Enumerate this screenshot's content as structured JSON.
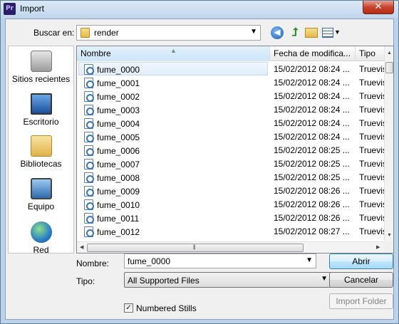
{
  "window": {
    "title": "Import",
    "app_icon": "Pr",
    "close_glyph": "✕"
  },
  "toolbar": {
    "look_in_label": "Buscar en:",
    "look_in_value": "render",
    "icons": [
      "back-icon",
      "up-folder-icon",
      "new-folder-icon",
      "view-menu-icon"
    ]
  },
  "places": [
    {
      "label": "Sitios recientes",
      "icon": "recent-places-icon"
    },
    {
      "label": "Escritorio",
      "icon": "desktop-icon"
    },
    {
      "label": "Bibliotecas",
      "icon": "libraries-icon"
    },
    {
      "label": "Equipo",
      "icon": "computer-icon"
    },
    {
      "label": "Red",
      "icon": "network-icon"
    }
  ],
  "list": {
    "columns": [
      "Nombre",
      "Fecha de modifica...",
      "Tipo"
    ],
    "sort_column": "Nombre",
    "rows": [
      {
        "name": "fume_0000",
        "date": "15/02/2012 08:24 ...",
        "type": "Truevision"
      },
      {
        "name": "fume_0001",
        "date": "15/02/2012 08:24 ...",
        "type": "Truevision"
      },
      {
        "name": "fume_0002",
        "date": "15/02/2012 08:24 ...",
        "type": "Truevision"
      },
      {
        "name": "fume_0003",
        "date": "15/02/2012 08:24 ...",
        "type": "Truevision"
      },
      {
        "name": "fume_0004",
        "date": "15/02/2012 08:24 ...",
        "type": "Truevision"
      },
      {
        "name": "fume_0005",
        "date": "15/02/2012 08:24 ...",
        "type": "Truevision"
      },
      {
        "name": "fume_0006",
        "date": "15/02/2012 08:25 ...",
        "type": "Truevision"
      },
      {
        "name": "fume_0007",
        "date": "15/02/2012 08:25 ...",
        "type": "Truevision"
      },
      {
        "name": "fume_0008",
        "date": "15/02/2012 08:25 ...",
        "type": "Truevision"
      },
      {
        "name": "fume_0009",
        "date": "15/02/2012 08:26 ...",
        "type": "Truevision"
      },
      {
        "name": "fume_0010",
        "date": "15/02/2012 08:26 ...",
        "type": "Truevision"
      },
      {
        "name": "fume_0011",
        "date": "15/02/2012 08:26 ...",
        "type": "Truevision"
      },
      {
        "name": "fume_0012",
        "date": "15/02/2012 08:27 ...",
        "type": "Truevision"
      }
    ],
    "selected_index": 0
  },
  "form": {
    "name_label": "Nombre:",
    "name_value": "fume_0000",
    "type_label": "Tipo:",
    "type_value": "All Supported Files",
    "open_label": "Abrir",
    "cancel_label": "Cancelar",
    "import_folder_label": "Import Folder",
    "numbered_stills_label": "Numbered Stills",
    "numbered_stills_checked": true,
    "check_glyph": "✓"
  },
  "colors": {
    "title_bar": "#c2d6ec",
    "close_button": "#c7432c",
    "selected_row": "#e0edf9",
    "default_button": "#a7d9f5"
  }
}
